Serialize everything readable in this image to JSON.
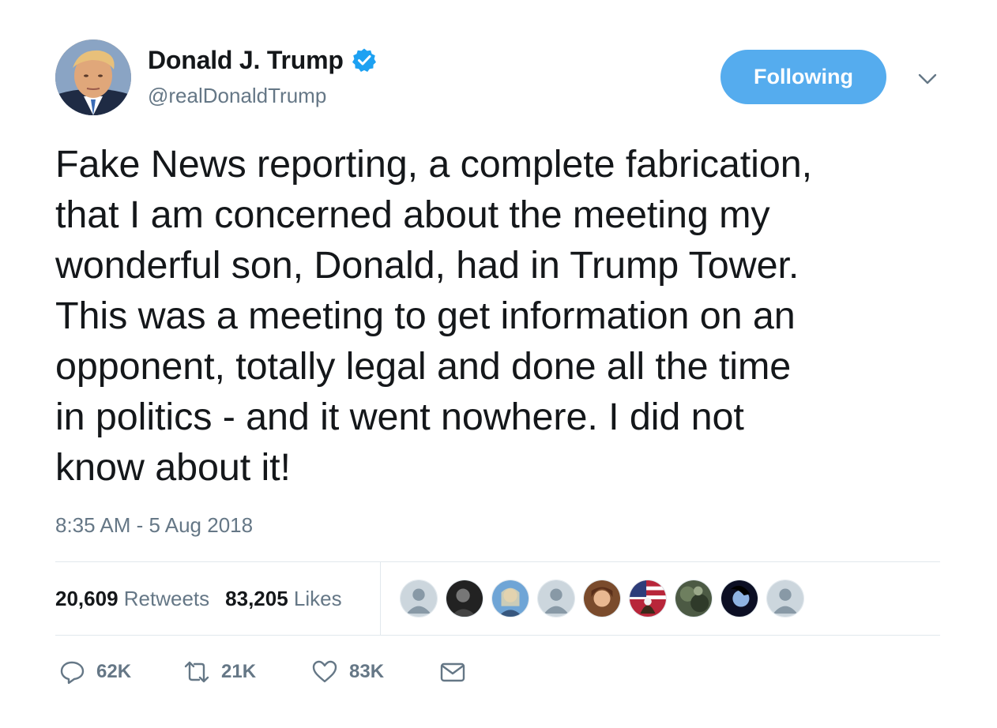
{
  "author": {
    "display_name": "Donald J. Trump",
    "handle": "@realDonaldTrump",
    "verified": true
  },
  "follow_button": {
    "label": "Following"
  },
  "tweet": {
    "text": "Fake News reporting, a complete fabrication,\nthat I am concerned about the meeting my\nwonderful son, Donald, had in Trump Tower.\nThis was a meeting to get information on an\nopponent, totally legal and done all the time\nin politics - and it went nowhere. I did not\nknow about it!",
    "timestamp": "8:35 AM - 5 Aug 2018"
  },
  "stats": {
    "retweets_count": "20,609",
    "retweets_label": "Retweets",
    "likes_count": "83,205",
    "likes_label": "Likes"
  },
  "actions": {
    "reply_count": "62K",
    "retweet_count": "21K",
    "like_count": "83K"
  },
  "icons": {
    "verified": "verified-badge-icon",
    "caret": "chevron-down-icon",
    "reply": "reply-icon",
    "retweet": "retweet-icon",
    "like": "heart-icon",
    "message": "envelope-icon"
  },
  "colors": {
    "accent": "#55acee",
    "verified": "#1da1f2",
    "text_primary": "#14171a",
    "text_secondary": "#657786",
    "divider": "#e1e8ed"
  }
}
